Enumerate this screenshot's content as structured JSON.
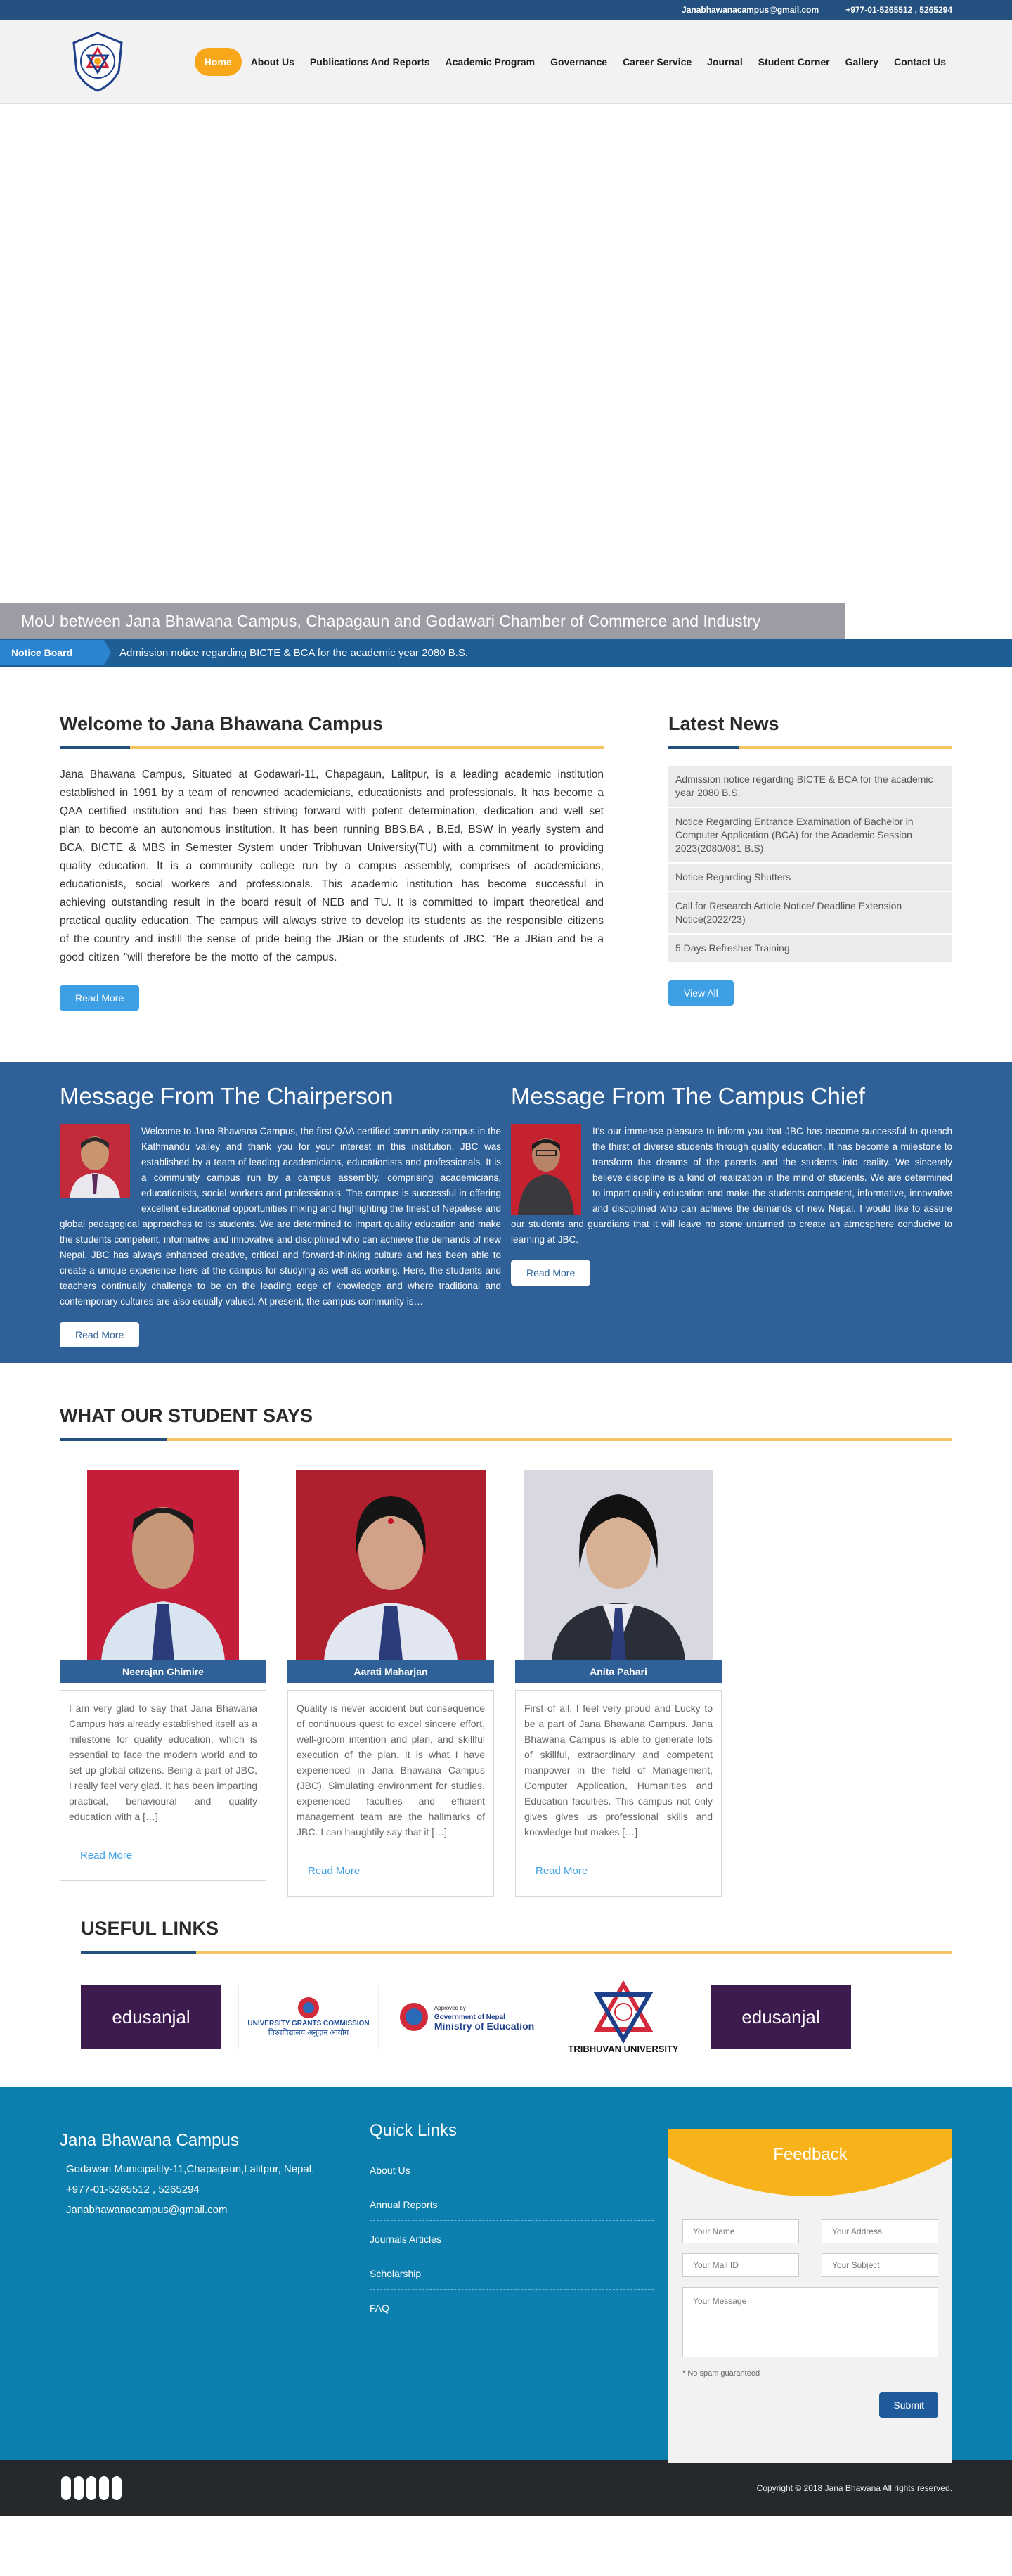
{
  "topbar": {
    "email": "Janabhawanacampus@gmail.com",
    "phone": "+977-01-5265512 , 5265294"
  },
  "nav": [
    "Home",
    "About Us",
    "Publications And Reports",
    "Academic Program",
    "Governance",
    "Career Service",
    "Journal",
    "Student Corner",
    "Gallery",
    "Contact Us"
  ],
  "hero": {
    "caption": "MoU between Jana Bhawana Campus, Chapagaun and Godawari Chamber of Commerce and Industry"
  },
  "notice": {
    "label": "Notice Board",
    "text": "Admission notice regarding BICTE & BCA for the academic year 2080 B.S."
  },
  "welcome": {
    "title": "Welcome to Jana Bhawana Campus",
    "body": "Jana Bhawana Campus, Situated at Godawari-11, Chapagaun, Lalitpur, is a leading academic institution established in 1991 by a team of renowned academicians, educationists and professionals. It has  become a QAA certified institution and has been striving forward with potent determination, dedication and well set plan to become an autonomous institution.  It has been running BBS,BA , B.Ed, BSW in yearly system and BCA, BICTE & MBS in Semester System under Tribhuvan University(TU) with a commitment to providing quality education. It is a community college run by a campus assembly, comprises of academicians, educationists, social workers and professionals. This academic institution has become successful in achieving outstanding result in the board result of NEB and TU. It is committed to impart theoretical and practical quality education. The campus will always strive to develop its students as the responsible citizens of the country and instill the sense of pride being the JBian or the students of JBC. “Be a JBian and be a good citizen ”will therefore be the motto of the campus.",
    "read_more": "Read More"
  },
  "news": {
    "title": "Latest News",
    "items": [
      "Admission notice regarding BICTE & BCA for the academic year 2080 B.S.",
      "Notice Regarding Entrance Examination of Bachelor in Computer Application (BCA) for the Academic Session 2023(2080/081 B.S)",
      "Notice Regarding Shutters",
      "Call for Research Article Notice/ Deadline Extension Notice(2022/23)",
      "5 Days Refresher Training"
    ],
    "view_all": "View All"
  },
  "chair": {
    "title": "Message From The Chairperson",
    "body": "Welcome to Jana Bhawana Campus, the first QAA certified community campus in the Kathmandu valley and thank you for your interest in this institution. JBC was established by a team of leading academicians, educationists and professionals. It is a community campus run by a campus assembly, comprising academicians, educationists, social workers and professionals. The campus is successful in offering excellent educational opportunities mixing and highlighting the finest of Nepalese and global pedagogical approaches to its students. We are determined to impart quality education and make the students competent, informative and innovative and disciplined who can achieve the demands of new Nepal. JBC has always enhanced creative, critical and forward-thinking culture and has been able to create a unique experience here at the campus for studying as well as working. Here, the students and teachers continually challenge to be on the leading edge of knowledge and where traditional and contemporary cultures are also equally valued. At present, the campus community is…",
    "read_more": "Read More"
  },
  "chief": {
    "title": "Message From The Campus Chief",
    "body": "It’s our immense pleasure to inform you that JBC has become successful to quench the thirst of diverse students through quality education. It has become a milestone to transform the dreams of the parents and the students into reality. We sincerely believe discipline is a kind of realization in the mind of students. We are determined to impart quality education and make the students competent, informative, innovative and disciplined who can achieve the demands of new Nepal. I would like to assure our students and guardians that it will leave no stone unturned to create an atmosphere conducive to learning at JBC.",
    "read_more": "Read More"
  },
  "students": {
    "title": "WHAT OUR STUDENT SAYS",
    "items": [
      {
        "name": "Neerajan Ghimire",
        "text": "I am very glad to say that Jana Bhawana Campus has already established itself as a milestone for quality education, which is essential to face the modern world and to set up global citizens. Being a part of JBC, I really feel very glad. It has been imparting practical, behavioural and quality education with a […]",
        "read_more": "Read More",
        "bg": "#c41e3a"
      },
      {
        "name": "Aarati Maharjan",
        "text": "Quality is never accident but consequence of continuous quest to excel sincere effort, well-groom intention and plan, and skillful execution of the plan. It is what I have experienced in Jana Bhawana Campus (JBC). Simulating environment for studies, experienced faculties and efficient management team are the hallmarks of JBC. I can haughtily say that it […]",
        "read_more": "Read More",
        "bg": "#b01f2e"
      },
      {
        "name": "Anita Pahari",
        "text": "First of all, I feel very proud and Lucky to be a part of Jana Bhawana Campus. Jana Bhawana Campus is able to generate lots of skillful, extraordinary and competent manpower in the field of Management, Computer Application, Humanities and Education faculties. This campus not only gives gives us professional skills and knowledge but makes […]",
        "read_more": "Read More",
        "bg": "#d8d8e0"
      }
    ]
  },
  "useful": {
    "title": "USEFUL LINKS",
    "items": [
      {
        "label": "edusanjal"
      },
      {
        "label": "UNIVERSITY GRANTS COMMISSION",
        "sub": "विश्वविद्यालय अनुदान आयोग"
      },
      {
        "label": "Ministry of Education",
        "pre": "Approved by",
        "mid": "Government of Nepal"
      },
      {
        "label": "TRIBHUVAN UNIVERSITY"
      },
      {
        "label": "edusanjal"
      }
    ]
  },
  "footer": {
    "title": "Jana Bhawana Campus",
    "address": "Godawari Municipality-11,Chapagaun,Lalitpur, Nepal.",
    "phone": "+977-01-5265512 , 5265294",
    "email": "Janabhawanacampus@gmail.com",
    "quick_title": "Quick Links",
    "quick": [
      "About Us",
      "Annual Reports",
      "Journals Articles",
      "Scholarship",
      "FAQ"
    ],
    "feedback": {
      "title": "Feedback",
      "name": "Your Name",
      "address": "Your Address",
      "mail": "Your Mail ID",
      "subject": "Your Subject",
      "message": "Your Message",
      "spam": "* No spam guaranteed",
      "submit": "Submit"
    }
  },
  "copyright": "Copyright © 2018 Jana Bhawana All rights reserved.",
  "colors": {
    "primary": "#2f6198",
    "accent": "#f8a71a",
    "footer": "#0d7fae",
    "button": "#3da0e4"
  }
}
